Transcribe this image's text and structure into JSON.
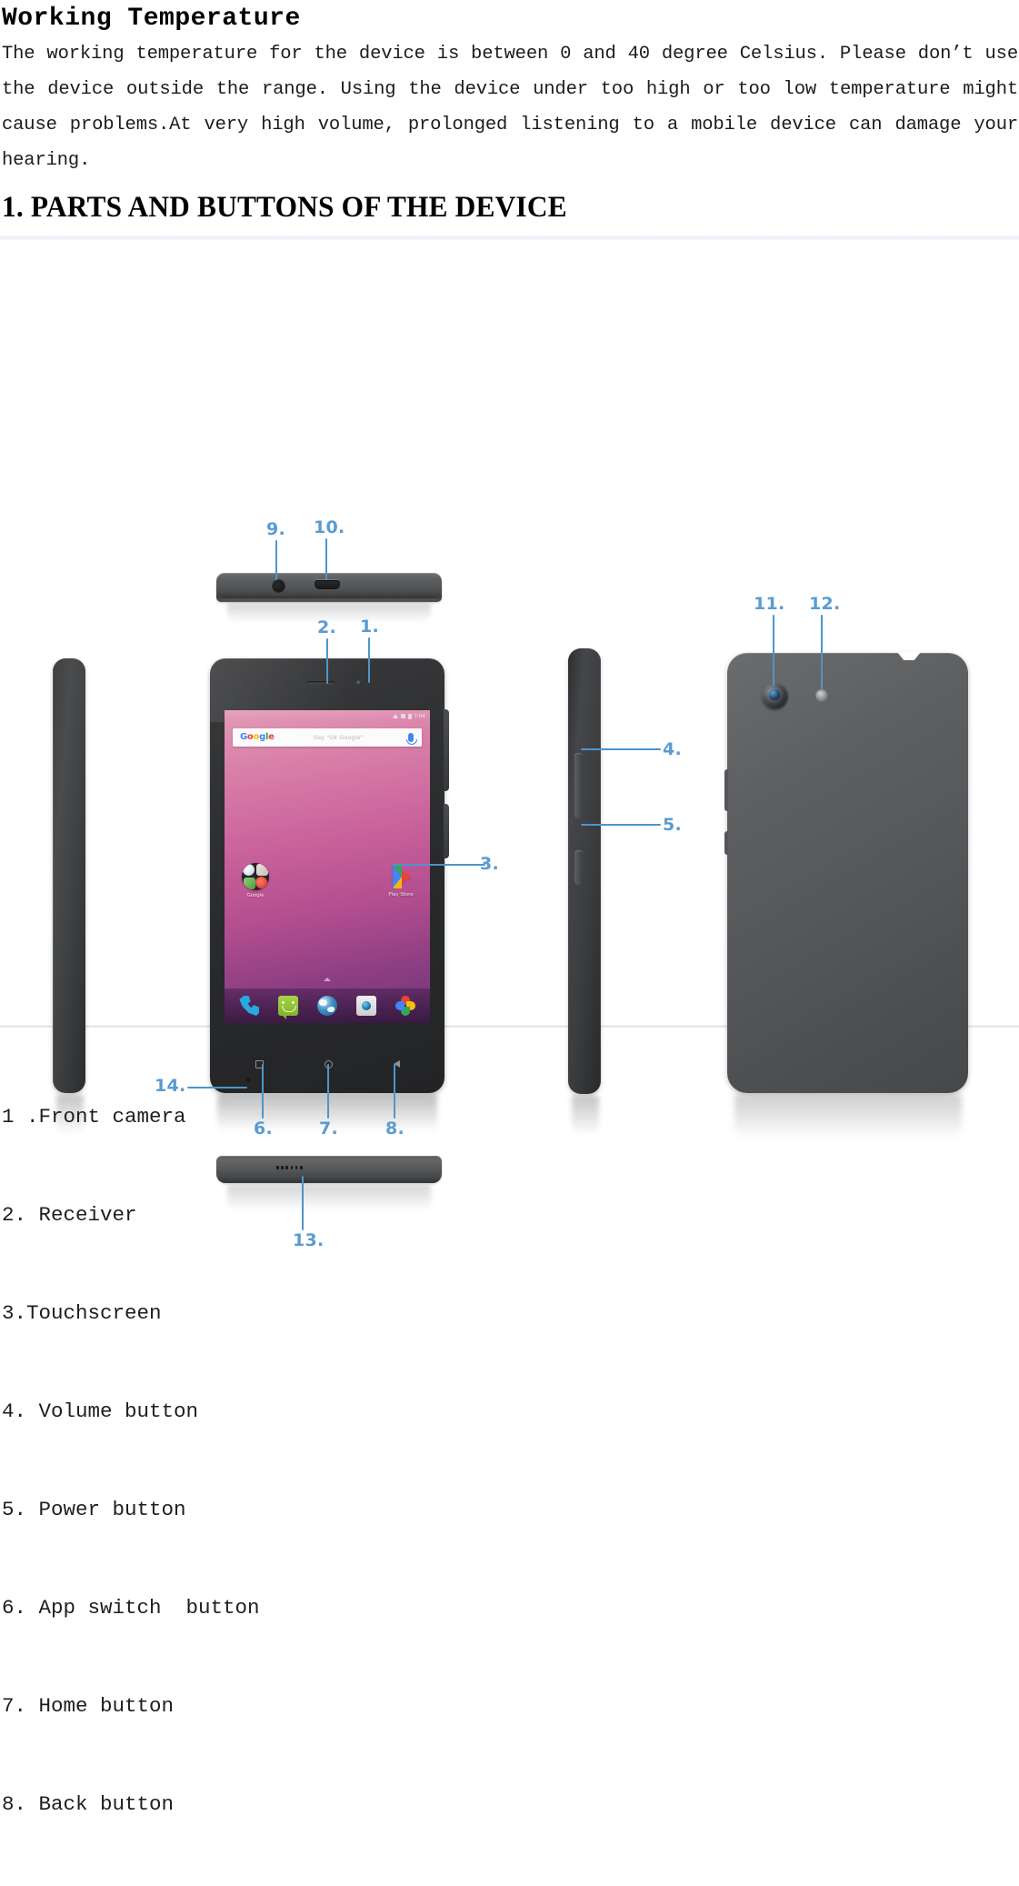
{
  "section": {
    "title": "Working Temperature",
    "paragraph": "The working temperature for the device is between 0 and 40 degree Celsius. Please don’t use the device outside the range. Using the device under too high or too low temperature might cause problems.At very high volume, prolonged listening to a mobile device can damage your hearing."
  },
  "heading": {
    "text": "1. PARTS AND BUTTONS OF THE DEVICE"
  },
  "figure": {
    "callouts": [
      {
        "id": "1",
        "label": "1."
      },
      {
        "id": "2",
        "label": "2."
      },
      {
        "id": "3",
        "label": "3."
      },
      {
        "id": "4",
        "label": "4."
      },
      {
        "id": "5",
        "label": "5."
      },
      {
        "id": "6",
        "label": "6."
      },
      {
        "id": "7",
        "label": "7."
      },
      {
        "id": "8",
        "label": "8."
      },
      {
        "id": "9",
        "label": "9."
      },
      {
        "id": "10",
        "label": "10."
      },
      {
        "id": "11",
        "label": "11."
      },
      {
        "id": "12",
        "label": "12."
      },
      {
        "id": "13",
        "label": "13."
      },
      {
        "id": "14",
        "label": "14."
      }
    ],
    "callout_color": "#5b9bd0",
    "device_color": "#4e5052",
    "screen": {
      "wallpaper_top": "#e29ab6",
      "wallpaper_bottom": "#6d3577",
      "status_time": "7:04",
      "search": {
        "logo_letters": [
          "G",
          "o",
          "o",
          "g",
          "l",
          "e"
        ],
        "placeholder": "Say \"Ok Google\"",
        "mic_icon": "microphone-icon"
      },
      "apps": [
        {
          "name": "Google",
          "icon": "google-folder-icon"
        },
        {
          "name": "Play Store",
          "icon": "play-store-icon"
        }
      ],
      "dock": [
        {
          "name": "Phone",
          "icon": "phone-icon"
        },
        {
          "name": "Messages",
          "icon": "message-icon"
        },
        {
          "name": "Browser",
          "icon": "browser-globe-icon"
        },
        {
          "name": "Camera",
          "icon": "camera-icon"
        },
        {
          "name": "Photos",
          "icon": "photos-icon"
        }
      ],
      "nav": [
        {
          "name": "App switch",
          "icon": "square-icon"
        },
        {
          "name": "Home",
          "icon": "circle-icon"
        },
        {
          "name": "Back",
          "icon": "triangle-left-icon"
        }
      ]
    }
  },
  "parts_list": [
    "1 .Front camera",
    "2. Receiver",
    "3.Touchscreen",
    "4. Volume button",
    "5. Power button",
    "6. App switch  button",
    "7. Home button",
    "8. Back button"
  ]
}
